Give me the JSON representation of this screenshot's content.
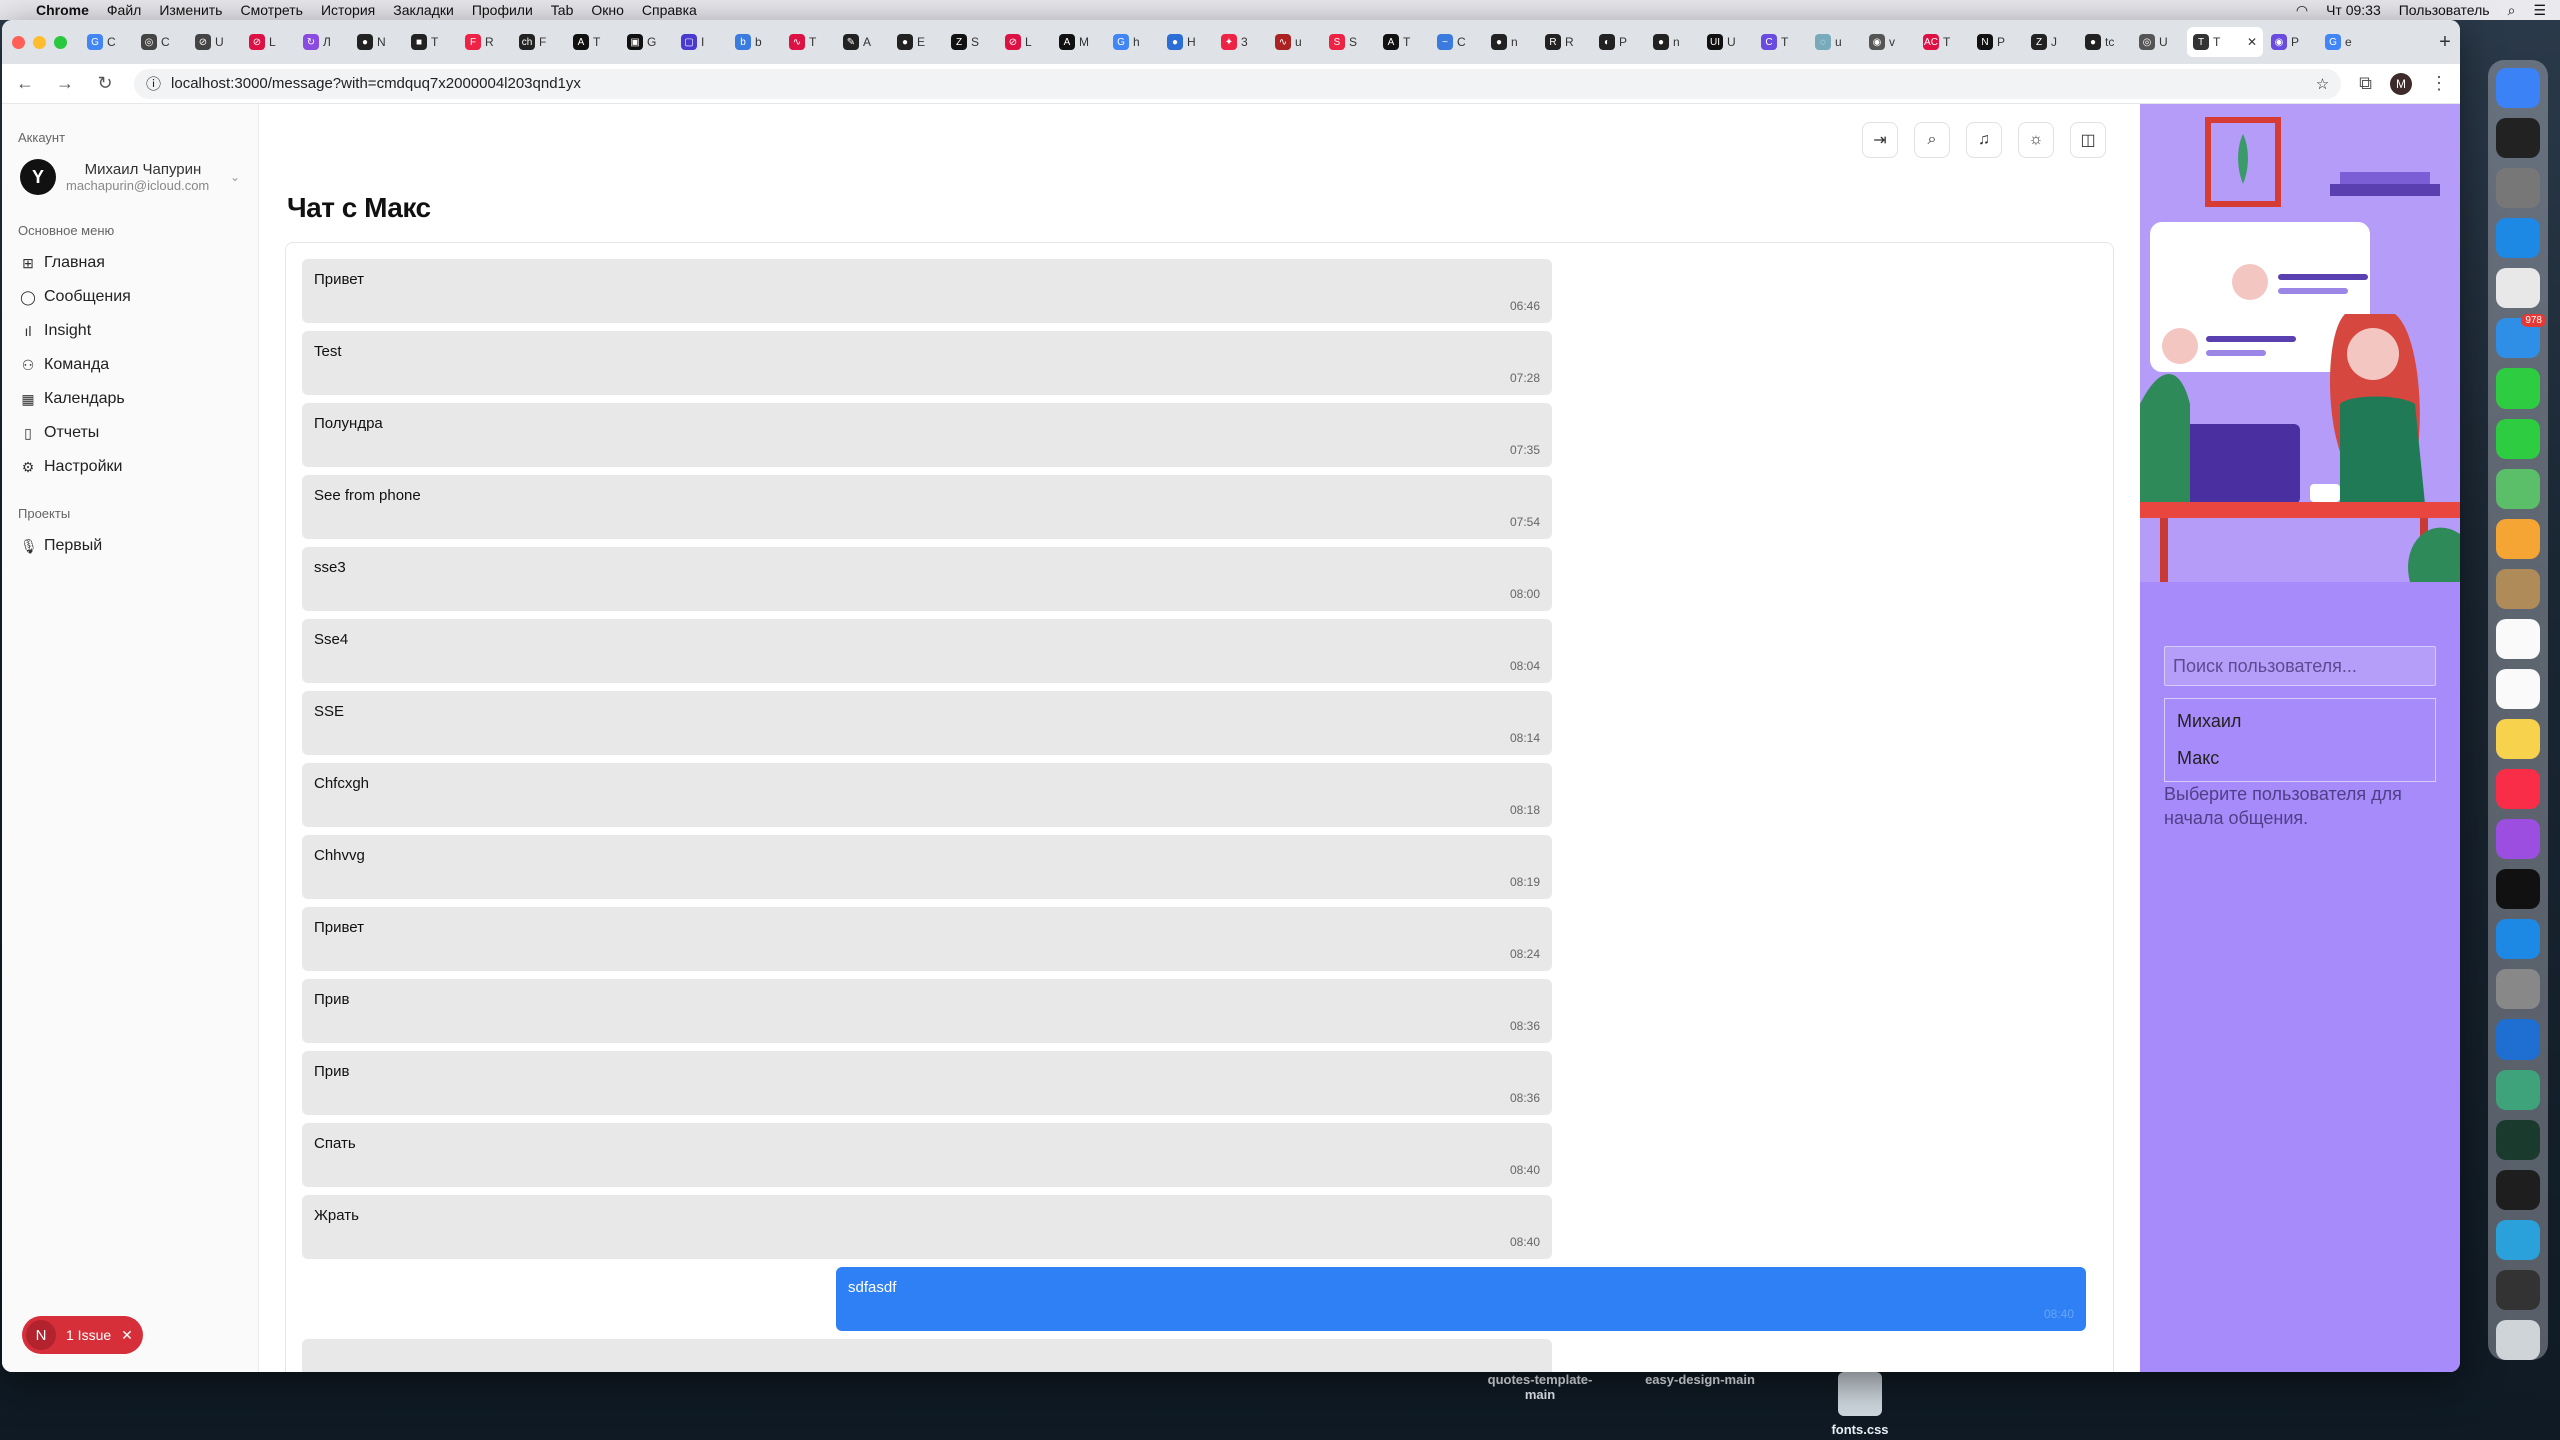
{
  "menubar": {
    "app_name": "Chrome",
    "items": [
      "Файл",
      "Изменить",
      "Смотреть",
      "История",
      "Закладки",
      "Профили",
      "Tab",
      "Окно",
      "Справка"
    ],
    "clock": "Чт 09:33",
    "user": "Пользователь"
  },
  "browser": {
    "tabs": [
      {
        "icon": "G",
        "label": "C",
        "color": "#4285f4"
      },
      {
        "icon": "◎",
        "label": "C",
        "color": "#444"
      },
      {
        "icon": "⊘",
        "label": "U",
        "color": "#444"
      },
      {
        "icon": "⊘",
        "label": "L",
        "color": "#d14"
      },
      {
        "icon": "↻",
        "label": "Л",
        "color": "#8a4be0"
      },
      {
        "icon": "●",
        "label": "N",
        "color": "#222"
      },
      {
        "icon": "■",
        "label": "T",
        "color": "#222"
      },
      {
        "icon": "F",
        "label": "R",
        "color": "#e24"
      },
      {
        "icon": "ch",
        "label": "F",
        "color": "#222"
      },
      {
        "icon": "A",
        "label": "T",
        "color": "#111"
      },
      {
        "icon": "▣",
        "label": "G",
        "color": "#111"
      },
      {
        "icon": "▢",
        "label": "I",
        "color": "#4a3ad0"
      },
      {
        "icon": "b",
        "label": "b",
        "color": "#3b7be0"
      },
      {
        "icon": "∿",
        "label": "T",
        "color": "#d14"
      },
      {
        "icon": "✎",
        "label": "A",
        "color": "#222"
      },
      {
        "icon": "●",
        "label": "E",
        "color": "#222"
      },
      {
        "icon": "Z",
        "label": "S",
        "color": "#111"
      },
      {
        "icon": "⊘",
        "label": "L",
        "color": "#d14"
      },
      {
        "icon": "A",
        "label": "M",
        "color": "#111"
      },
      {
        "icon": "G",
        "label": "h",
        "color": "#4285f4"
      },
      {
        "icon": "●",
        "label": "H",
        "color": "#2b6fd6"
      },
      {
        "icon": "✦",
        "label": "3",
        "color": "#e24"
      },
      {
        "icon": "∿",
        "label": "u",
        "color": "#a22"
      },
      {
        "icon": "S",
        "label": "S",
        "color": "#e24"
      },
      {
        "icon": "A",
        "label": "T",
        "color": "#111"
      },
      {
        "icon": "~",
        "label": "C",
        "color": "#3b7be0"
      },
      {
        "icon": "●",
        "label": "n",
        "color": "#222"
      },
      {
        "icon": "R",
        "label": "R",
        "color": "#222"
      },
      {
        "icon": "◐",
        "label": "P",
        "color": "#222"
      },
      {
        "icon": "●",
        "label": "n",
        "color": "#222"
      },
      {
        "icon": "UI",
        "label": "U",
        "color": "#111"
      },
      {
        "icon": "C",
        "label": "T",
        "color": "#6a4be0"
      },
      {
        "icon": "◌",
        "label": "u",
        "color": "#7ab"
      },
      {
        "icon": "◉",
        "label": "v",
        "color": "#555"
      },
      {
        "icon": "AC",
        "label": "T",
        "color": "#d14"
      },
      {
        "icon": "N",
        "label": "P",
        "color": "#111"
      },
      {
        "icon": "Z",
        "label": "J",
        "color": "#222"
      },
      {
        "icon": "●",
        "label": "tc",
        "color": "#222"
      },
      {
        "icon": "◎",
        "label": "U",
        "color": "#555"
      },
      {
        "icon": "T",
        "label": "T",
        "color": "#333",
        "active": true
      },
      {
        "icon": "◉",
        "label": "P",
        "color": "#6a4be0"
      },
      {
        "icon": "G",
        "label": "e",
        "color": "#4285f4"
      }
    ],
    "url": "localhost:3000/message?with=cmdquq7x2000004l203qnd1yx"
  },
  "sidebar": {
    "account_label": "Аккаунт",
    "account_name": "Михаил Чапурин",
    "account_email": "machapurin@icloud.com",
    "menu_label": "Основное меню",
    "menu": [
      {
        "label": "Главная",
        "icon": "grid-icon"
      },
      {
        "label": "Сообщения",
        "icon": "chat-bubble-icon"
      },
      {
        "label": "Insight",
        "icon": "bar-chart-icon"
      },
      {
        "label": "Команда",
        "icon": "users-icon"
      },
      {
        "label": "Календарь",
        "icon": "calendar-icon"
      },
      {
        "label": "Отчеты",
        "icon": "report-icon"
      },
      {
        "label": "Настройки",
        "icon": "gear-icon"
      }
    ],
    "projects_label": "Проекты",
    "projects": [
      {
        "label": "Первый",
        "icon": "🎙"
      }
    ],
    "issue_label": "1 Issue",
    "issue_badge": "N"
  },
  "chat": {
    "title": "Чат с Макс",
    "messages": [
      {
        "text": "Привет",
        "time": "06:46",
        "mine": false
      },
      {
        "text": "Test",
        "time": "07:28",
        "mine": false
      },
      {
        "text": "Полундра",
        "time": "07:35",
        "mine": false
      },
      {
        "text": "See from phone",
        "time": "07:54",
        "mine": false
      },
      {
        "text": "sse3",
        "time": "08:00",
        "mine": false
      },
      {
        "text": "Sse4",
        "time": "08:04",
        "mine": false
      },
      {
        "text": "SSE",
        "time": "08:14",
        "mine": false
      },
      {
        "text": "Chfcxgh",
        "time": "08:18",
        "mine": false
      },
      {
        "text": "Chhvvg",
        "time": "08:19",
        "mine": false
      },
      {
        "text": "Привет",
        "time": "08:24",
        "mine": false
      },
      {
        "text": "Прив",
        "time": "08:36",
        "mine": false
      },
      {
        "text": "Прив",
        "time": "08:36",
        "mine": false
      },
      {
        "text": "Спать",
        "time": "08:40",
        "mine": false
      },
      {
        "text": "Жрать",
        "time": "08:40",
        "mine": false
      },
      {
        "text": "sdfasdf",
        "time": "08:40",
        "mine": true
      },
      {
        "text": "",
        "time": "",
        "mine": false
      }
    ]
  },
  "users_panel": {
    "search_placeholder": "Поиск пользователя...",
    "users": [
      "Михаил",
      "Макс"
    ],
    "hint": "Выберите пользователя для начала общения."
  },
  "desktop": {
    "files": [
      {
        "name": "quotes-template-main"
      },
      {
        "name": "easy-design-main"
      },
      {
        "name": "fonts.css"
      }
    ]
  },
  "dock": {
    "apps": [
      {
        "name": "finder",
        "color": "#3b82f6"
      },
      {
        "name": "terminal",
        "color": "#222"
      },
      {
        "name": "launchpad",
        "color": "#777"
      },
      {
        "name": "safari",
        "color": "#1e88e5"
      },
      {
        "name": "chrome",
        "color": "#e8e8e8"
      },
      {
        "name": "mail",
        "color": "#2f8fe6",
        "badge": "978"
      },
      {
        "name": "facetime",
        "color": "#2ecc40"
      },
      {
        "name": "messages",
        "color": "#2ecc40"
      },
      {
        "name": "maps",
        "color": "#5bbf6a"
      },
      {
        "name": "photos",
        "color": "#f4a534"
      },
      {
        "name": "contacts",
        "color": "#b08b5a"
      },
      {
        "name": "calendar",
        "color": "#fafafa"
      },
      {
        "name": "reminders",
        "color": "#fafafa"
      },
      {
        "name": "notes",
        "color": "#f7d24c"
      },
      {
        "name": "music",
        "color": "#fa2d48"
      },
      {
        "name": "podcasts",
        "color": "#9b4ee0"
      },
      {
        "name": "tv",
        "color": "#111"
      },
      {
        "name": "app-store",
        "color": "#1e88e5"
      },
      {
        "name": "system-settings",
        "color": "#888"
      },
      {
        "name": "vscode",
        "color": "#1f6fd2"
      },
      {
        "name": "chatgpt",
        "color": "#3ea37a"
      },
      {
        "name": "mongodb",
        "color": "#1b3a2e"
      },
      {
        "name": "figma",
        "color": "#1e1e1e"
      },
      {
        "name": "telegram",
        "color": "#2aa1da"
      },
      {
        "name": "screen",
        "color": "#333"
      },
      {
        "name": "trash",
        "color": "#cfd4d9"
      }
    ]
  },
  "colors": {
    "accent_blue": "#2f80f5",
    "panel_purple": "#a78bfa",
    "issue_red": "#d62f3a"
  }
}
